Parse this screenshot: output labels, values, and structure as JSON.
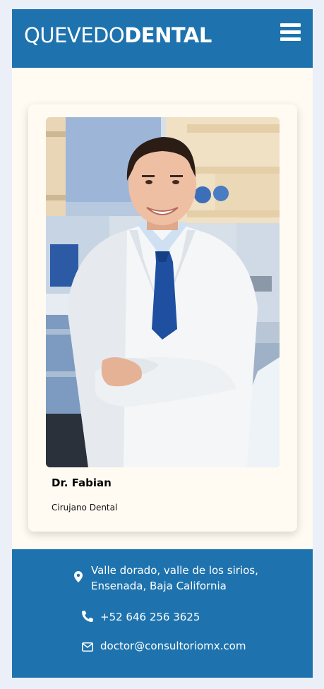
{
  "header": {
    "brand_light": "QUEVEDO",
    "brand_bold": "DENTAL",
    "menu_icon": "hamburger-menu-icon",
    "background_color": "#1e73ae"
  },
  "card": {
    "photo_alt": "doctor-photo",
    "name": "Dr. Fabian",
    "role": "Cirujano Dental"
  },
  "footer": {
    "address_line1": "Valle dorado, valle de los sirios,",
    "address_line2": "Ensenada, Baja California",
    "phone": "+52 646 256 3625",
    "email": "doctor@consultoriomx.com",
    "icons": [
      "map-pin-icon",
      "phone-icon",
      "envelope-icon"
    ],
    "background_color": "#1e73ae"
  }
}
